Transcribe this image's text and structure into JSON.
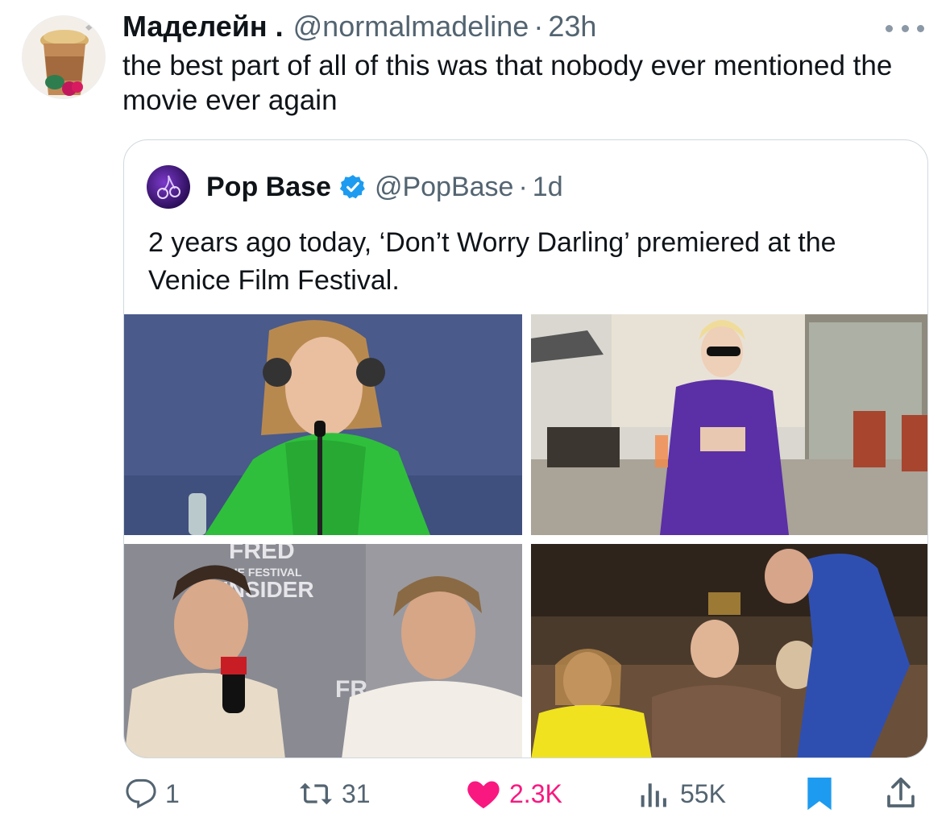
{
  "tweet": {
    "display_name": "Маделейн .",
    "handle": "@normalmadeline",
    "separator": "·",
    "time": "23h",
    "text": "the best part of all of this was that nobody ever mentioned the movie ever again",
    "avatar_icon": "iced-coffee-avatar",
    "more_icon": "more-dots-icon"
  },
  "quoted": {
    "display_name": "Pop Base",
    "verified": true,
    "verified_color": "#1d9bf0",
    "handle": "@PopBase",
    "separator": "·",
    "time": "1d",
    "text": "2 years ago today, ‘Don’t Worry Darling’ premiered at the Venice Film Festival.",
    "avatar_icon": "cherry-logo-icon",
    "media": [
      {
        "name": "press-conference-woman-green-jacket"
      },
      {
        "name": "woman-purple-outfit-holding-drink"
      },
      {
        "name": "press-conference-two-men",
        "text": [
          "FRED",
          "THE FESTIVAL",
          "INSIDER",
          "FR"
        ]
      },
      {
        "name": "audience-applauding-premiere"
      }
    ]
  },
  "actions": {
    "reply_count": "1",
    "retweet_count": "31",
    "like_count": "2.3K",
    "like_color": "#f91880",
    "views_count": "55K",
    "bookmark_color": "#1d9bf0",
    "icons": [
      "reply-icon",
      "retweet-icon",
      "like-heart-icon",
      "views-icon",
      "bookmark-icon",
      "share-icon"
    ]
  }
}
